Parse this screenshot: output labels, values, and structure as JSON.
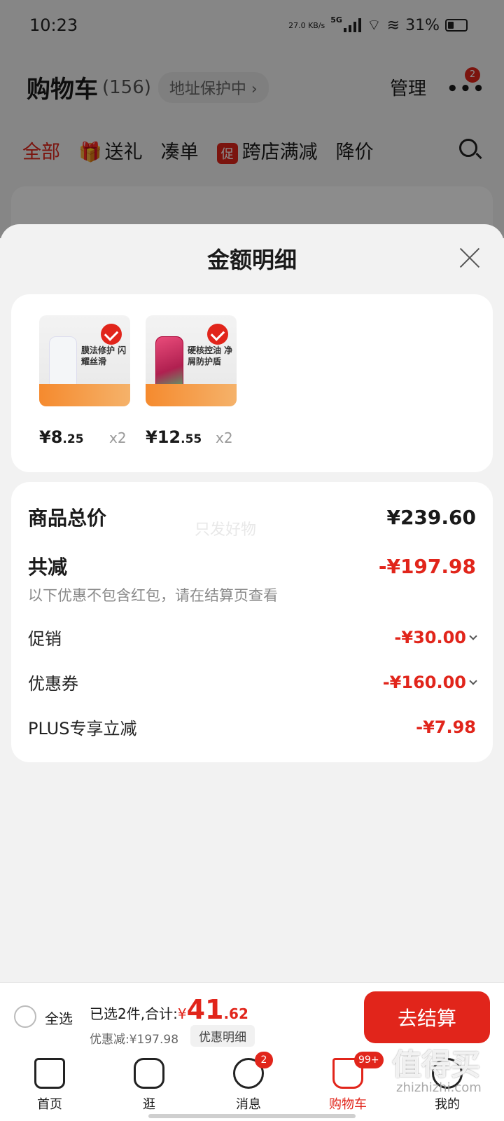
{
  "status_bar": {
    "time": "10:23",
    "net_speed": "27.0 KB/s",
    "network": "5G",
    "battery": "31%"
  },
  "cart_header": {
    "title": "购物车",
    "count": "(156)",
    "address_pill": "地址保护中",
    "manage": "管理",
    "more_badge": "2"
  },
  "filter_tabs": {
    "all": "全部",
    "gift": "送礼",
    "combine": "凑单",
    "promo_badge": "促",
    "cross_store": "跨店满减",
    "price_drop": "降价"
  },
  "sheet": {
    "title": "金额明细",
    "products": [
      {
        "name_lines": "膜法修护 闪耀丝滑",
        "price_int": "¥8",
        "price_dec": ".25",
        "qty": "x2"
      },
      {
        "name_lines": "硬核控油 净屑防护盾",
        "price_int": "¥12",
        "price_dec": ".55",
        "qty": "x2"
      }
    ],
    "summary": {
      "total_label": "商品总价",
      "total_value": "¥239.60",
      "watermark": "只发好物",
      "reduce_label": "共减",
      "reduce_value": "-¥197.98",
      "note": "以下优惠不包含红包，请在结算页查看",
      "items": [
        {
          "label": "促销",
          "value": "-¥30.00"
        },
        {
          "label": "优惠券",
          "value": "-¥160.00"
        },
        {
          "label": "PLUS专享立减",
          "value": "-¥7.98"
        }
      ]
    }
  },
  "bottom_bar": {
    "select_all": "全选",
    "chosen_prefix": "已选2件,合计:",
    "yen": "¥",
    "amount_int": "41",
    "amount_dec": ".62",
    "discount": "优惠减:¥197.98",
    "detail_button": "优惠明细",
    "checkout": "去结算"
  },
  "tab_bar": [
    {
      "label": "首页"
    },
    {
      "label": "逛"
    },
    {
      "label": "消息",
      "badge": "2"
    },
    {
      "label": "购物车",
      "badge": "99+"
    },
    {
      "label": "我的"
    }
  ],
  "watermark": {
    "logo": "值得买",
    "site": "zhizhizhi.com"
  },
  "colors": {
    "accent": "#e1251b",
    "sheet_bg": "#f2f2f2"
  }
}
